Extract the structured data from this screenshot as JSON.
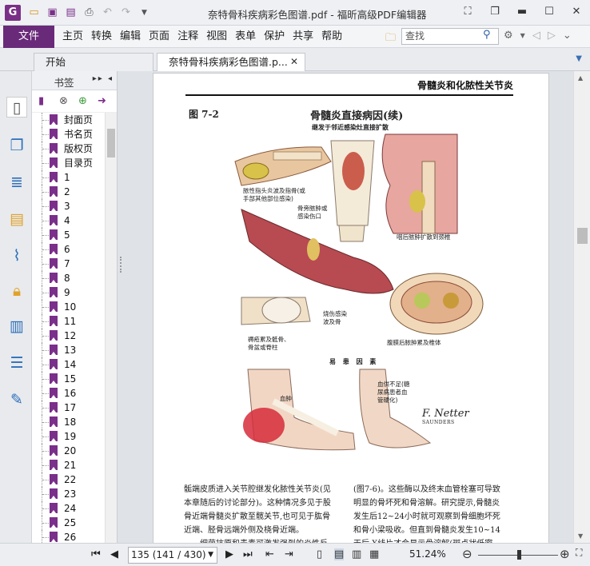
{
  "app": {
    "title": "奈特骨科疾病彩色图谱.pdf - 福昕高级PDF编辑器",
    "logo_letter": "G"
  },
  "quick_access": [
    "open-folder-icon",
    "save-icon",
    "save-as-icon",
    "print-icon",
    "undo-icon",
    "redo-icon",
    "customize-icon"
  ],
  "menu": {
    "file": "文件",
    "items": [
      "主页",
      "转换",
      "编辑",
      "页面",
      "注释",
      "视图",
      "表单",
      "保护",
      "共享",
      "帮助"
    ],
    "search_placeholder": "查找"
  },
  "tabs": {
    "start": "开始",
    "doc": "奈特骨科疾病彩色图谱.p..."
  },
  "bookmarks": {
    "title": "书签",
    "items": [
      "封面页",
      "书名页",
      "版权页",
      "目录页",
      "1",
      "2",
      "3",
      "4",
      "5",
      "6",
      "7",
      "8",
      "9",
      "10",
      "11",
      "12",
      "13",
      "14",
      "15",
      "16",
      "17",
      "18",
      "19",
      "20",
      "21",
      "22",
      "23",
      "24",
      "25",
      "26"
    ]
  },
  "page": {
    "running_head": "骨髓炎和化脓性关节炎",
    "figure_number": "图 7-2",
    "figure_title": "骨髓炎直接病因(续)",
    "figure_subtitle": "继发于邻近感染灶直接扩散",
    "labels": {
      "finger": "脓性指头炎波及指骨(或\n手部其他部位感染)",
      "leg_wound": "骨旁脓肿或\n感染伤口",
      "neck": "咽后脓肿扩散到颈椎",
      "burn": "烧伤感染\n波及骨",
      "decubitus": "褥疮累及骶骨、\n骨盆或脊柱",
      "abdomen": "腹膜后脓肿累及椎体",
      "risk_factors": "易 患 因 素",
      "hematoma": "血肿",
      "diabetes": "血供不足(糖\n尿病患者血\n管硬化)"
    },
    "signature": "F. Netter",
    "signature_sub": "SAUNDERS",
    "text_left": "骺端皮质进入关节腔继发化脓性关节炎(见本章随后的讨论部分)。这种情况多见于股骨近端骨髓炎扩散至髋关节,也可见于肱骨近端、胫骨远端外侧及桡骨近端。\n　　细菌抗原和毒素可激发强烈的炎性反",
    "text_right": "(图7-6)。这些酶以及终末血管栓塞可导致明显的骨坏死和骨溶解。研究提示,骨髓炎发生后12~24小时就可观察到骨细胞坏死和骨小梁吸收。但直到骨髓炎发生10~14天后,X线片才会显示骨溶解(斑点状低密度影);"
  },
  "status": {
    "page_field": "135 (141 / 430)",
    "zoom": "51.24%"
  },
  "colors": {
    "accent": "#6a2a7a",
    "bookmark_flag": "#7a2f8a",
    "link_blue": "#2d5ea8"
  }
}
